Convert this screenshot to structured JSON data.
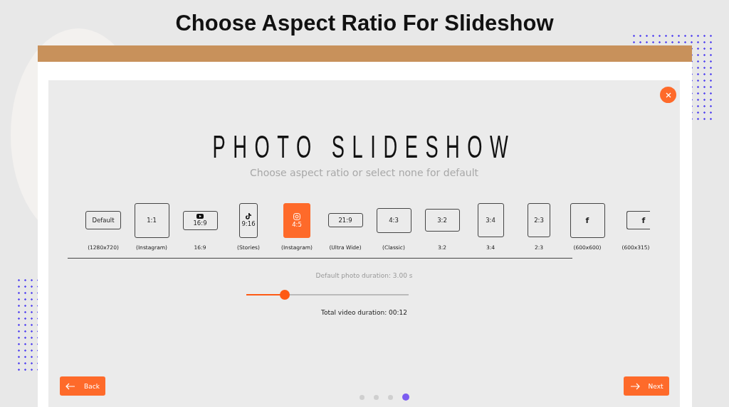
{
  "heading": "Choose Aspect Ratio For Slideshow",
  "app": {
    "title": "PHOTO SLIDESHOW",
    "subtitle": "Choose aspect ratio or select none for default",
    "ratios": [
      {
        "kind": "plain",
        "text": "Default",
        "label": "(1280x720)",
        "selected": false
      },
      {
        "kind": "plain",
        "text": "1:1",
        "label": "(Instagram)",
        "selected": false
      },
      {
        "kind": "video",
        "text": "16:9",
        "label": "16:9",
        "selected": false
      },
      {
        "kind": "music",
        "text": "9:16",
        "label": "(Stories)",
        "selected": false
      },
      {
        "kind": "camera",
        "text": "4:5",
        "label": "(Instagram)",
        "selected": true
      },
      {
        "kind": "plain",
        "text": "21:9",
        "label": "(Ultra Wide)",
        "selected": false
      },
      {
        "kind": "plain",
        "text": "4:3",
        "label": "(Classic)",
        "selected": false
      },
      {
        "kind": "plain",
        "text": "3:2",
        "label": "3:2",
        "selected": false
      },
      {
        "kind": "plain",
        "text": "3:4",
        "label": "3:4",
        "selected": false
      },
      {
        "kind": "plain",
        "text": "2:3",
        "label": "2:3",
        "selected": false
      },
      {
        "kind": "plain",
        "text": "f",
        "label": "(600x600)",
        "selected": false
      },
      {
        "kind": "plain",
        "text": "f",
        "label": "(600x315)",
        "selected": false
      }
    ],
    "duration": {
      "label": "Default photo duration: 3.00 s",
      "level": 0.24
    },
    "total": "Total video duration: 00:12",
    "back": "Back",
    "next": "Next",
    "pages": [
      {
        "selected": false
      },
      {
        "selected": false
      },
      {
        "selected": false
      },
      {
        "selected": true
      }
    ]
  }
}
